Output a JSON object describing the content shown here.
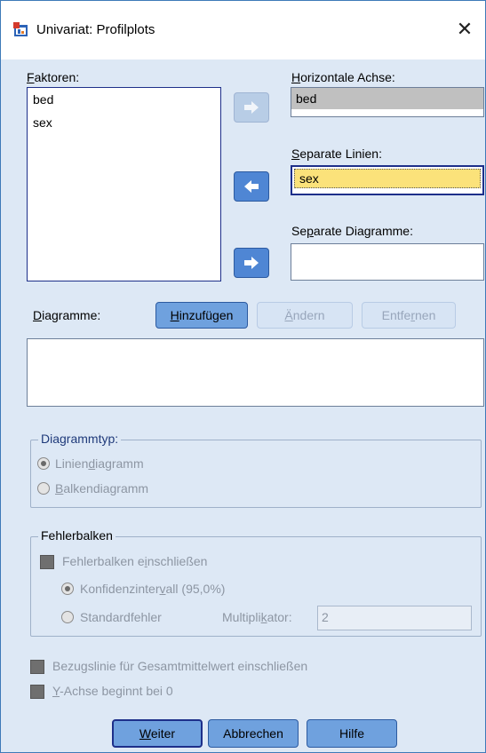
{
  "window": {
    "title": "Univariat: Profilplots",
    "close_glyph": "✕"
  },
  "factors": {
    "label": "Faktoren:",
    "items": [
      "bed",
      "sex"
    ]
  },
  "horizontal": {
    "label": "Horizontale Achse:",
    "value": "bed"
  },
  "separate_lines": {
    "label": "Separate Linien:",
    "value": "sex"
  },
  "separate_plots": {
    "label": "Separate Diagramme:",
    "value": ""
  },
  "plots": {
    "label": "Diagramme:",
    "add": "Hinzufügen",
    "change": "Ändern",
    "remove": "Entfernen"
  },
  "chart_type": {
    "legend": "Diagrammtyp:",
    "line": "Liniendiagramm",
    "bar": "Balkendiagramm",
    "selected": "line"
  },
  "error_bars": {
    "legend": "Fehlerbalken",
    "include": "Fehlerbalken einschließen",
    "ci": "Konfidenzintervall (95,0%)",
    "se": "Standardfehler",
    "multiplier_label": "Multiplikator:",
    "multiplier_value": "2"
  },
  "options": {
    "reference_line": "Bezugslinie für Gesamtmittelwert einschließen",
    "y_axis_zero": "Y-Achse beginnt bei 0"
  },
  "footer": {
    "continue": "Weiter",
    "cancel": "Abbrechen",
    "help": "Hilfe"
  },
  "colors": {
    "accent": "#4f86d4",
    "selection": "#fbe27a",
    "dialog_bg": "#dde8f5"
  },
  "icons": {
    "app": "spss-dialog-icon",
    "move": "arrow-right-icon",
    "move_back": "arrow-left-icon"
  }
}
